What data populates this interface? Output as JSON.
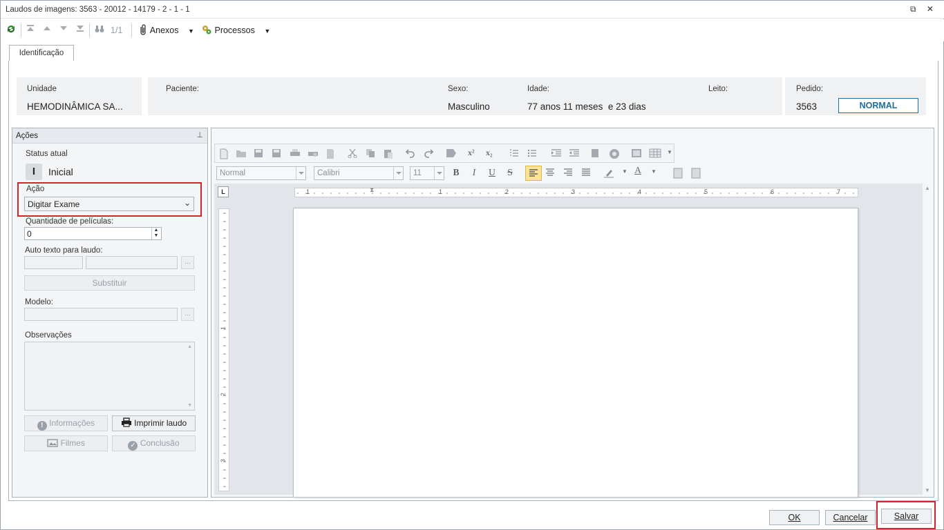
{
  "window": {
    "title": "Laudos de imagens: 3563 - 20012 - 14179 - 2 - 1 - 1",
    "controls": "⧉ ✕"
  },
  "toolbar": {
    "nav_count": "1/1",
    "anexos_label": "Anexos",
    "processos_label": "Processos"
  },
  "tabs": [
    {
      "label": "Identificação"
    }
  ],
  "header": {
    "unidade_label": "Unidade",
    "unidade_value": "HEMODINÂMICA SA...",
    "paciente_label": "Paciente:",
    "paciente_value": "",
    "sexo_label": "Sexo:",
    "sexo_value": "Masculino",
    "idade_label": "Idade:",
    "idade_value": "77 anos 11 meses  e 23 dias",
    "leito_label": "Leito:",
    "pedido_label": "Pedido:",
    "pedido_value": "3563",
    "priority_badge": "NORMAL"
  },
  "acoes": {
    "title": "Ações",
    "status_label": "Status atual",
    "status_letter": "I",
    "status_value": "Inicial",
    "acao_label": "Ação",
    "acao_value": "Digitar Exame",
    "quantidade_label": "Quantidade de películas:",
    "quantidade_value": "0",
    "auto_texto_label": "Auto texto para laudo:",
    "ellipsis": "...",
    "substituir_label": "Substituir",
    "modelo_label": "Modelo:",
    "observacoes_label": "Observações",
    "informacoes_label": "Informações",
    "imprimir_label": "Imprimir laudo",
    "filmes_label": "Filmes",
    "conclusao_label": "Conclusão"
  },
  "editor": {
    "style_value": "Normal",
    "font_value": "Calibri",
    "size_value": "11",
    "bold": "B",
    "italic": "I",
    "underline": "U",
    "strike": "S",
    "superscript": "x²",
    "subscript": "x₂",
    "ruler_numbers": [
      "1",
      "1",
      "2",
      "3",
      "4",
      "5",
      "6",
      "7"
    ],
    "vruler_numbers": [
      "1",
      "2",
      "3"
    ]
  },
  "footer": {
    "ok_label": "OK",
    "cancelar_label": "Cancelar",
    "salvar_label": "Salvar"
  },
  "colors": {
    "accent_red": "#d3242c",
    "badge_blue": "#1f6f9c"
  }
}
